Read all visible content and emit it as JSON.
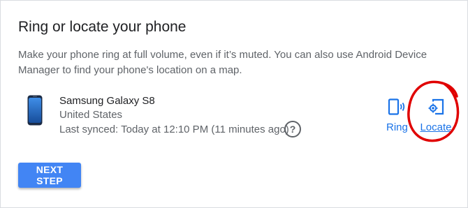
{
  "card": {
    "title": "Ring or locate your phone",
    "description": "Make your phone ring at full volume, even if it’s muted. You can also use Android Device Manager to find your phone's location on a map."
  },
  "device": {
    "name": "Samsung Galaxy S8",
    "country": "United States",
    "last_synced": "Last synced: Today at 12:10 PM (11 minutes ago)",
    "help_glyph": "?"
  },
  "actions": {
    "ring_label": "Ring",
    "ring_icon": "ring-phone-icon",
    "locate_label": "Locate",
    "locate_icon": "locate-phone-icon"
  },
  "button": {
    "next_label": "NEXT STEP"
  },
  "colors": {
    "accent": "#1a73e8",
    "button": "#4285f4",
    "highlight": "#e00000"
  }
}
